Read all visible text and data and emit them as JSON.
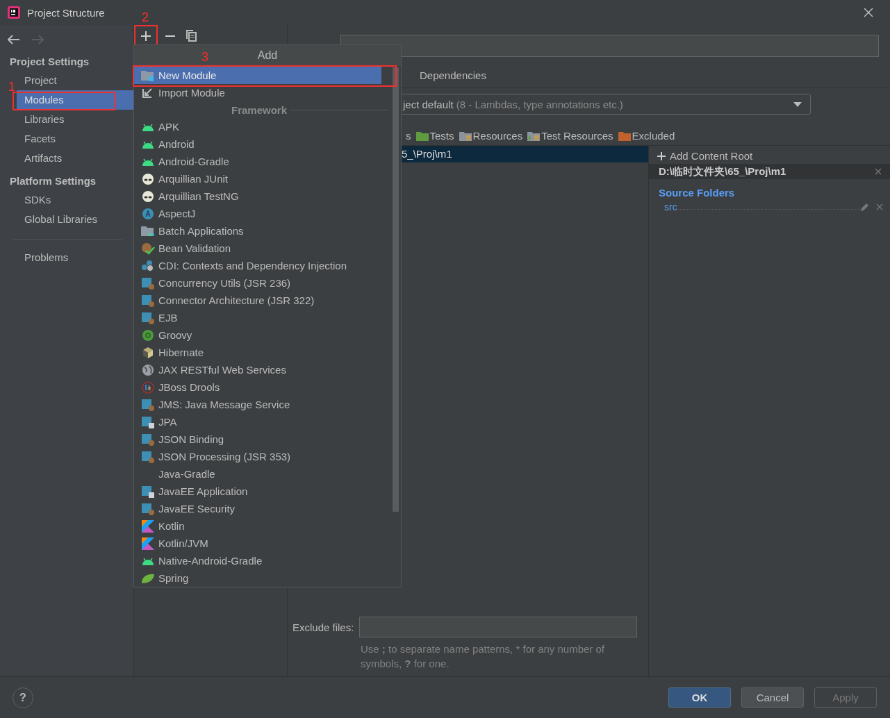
{
  "window": {
    "title": "Project Structure"
  },
  "sidebar": {
    "groups": [
      {
        "heading": "Project Settings",
        "items": [
          {
            "label": "Project",
            "selected": false
          },
          {
            "label": "Modules",
            "selected": true,
            "annotation": "1"
          },
          {
            "label": "Libraries",
            "selected": false
          },
          {
            "label": "Facets",
            "selected": false
          },
          {
            "label": "Artifacts",
            "selected": false
          }
        ]
      },
      {
        "heading": "Platform Settings",
        "items": [
          {
            "label": "SDKs",
            "selected": false
          },
          {
            "label": "Global Libraries",
            "selected": false
          }
        ]
      },
      {
        "items": [
          {
            "label": "Problems",
            "selected": false
          }
        ]
      }
    ]
  },
  "toolbar": {
    "add_annotation": "2"
  },
  "add_popup": {
    "title": "Add",
    "actions": [
      {
        "label": "New Module",
        "kind": "module",
        "selected": true,
        "annotation": "3"
      },
      {
        "label": "Import Module",
        "kind": "import",
        "selected": false
      }
    ],
    "section": "Framework",
    "frameworks": [
      {
        "label": "APK",
        "kind": "android",
        "selected": false
      },
      {
        "label": "Android",
        "kind": "android",
        "selected": false
      },
      {
        "label": "Android-Gradle",
        "kind": "android",
        "selected": false
      },
      {
        "label": "Arquillian JUnit",
        "kind": "alien",
        "selected": false
      },
      {
        "label": "Arquillian TestNG",
        "kind": "alien",
        "selected": false
      },
      {
        "label": "AspectJ",
        "kind": "aspectj",
        "selected": false
      },
      {
        "label": "Batch Applications",
        "kind": "batch",
        "selected": false
      },
      {
        "label": "Bean Validation",
        "kind": "bean",
        "selected": false
      },
      {
        "label": "CDI: Contexts and Dependency Injection",
        "kind": "cdi",
        "selected": false
      },
      {
        "label": "Concurrency Utils (JSR 236)",
        "kind": "jee",
        "selected": false
      },
      {
        "label": "Connector Architecture (JSR 322)",
        "kind": "jee",
        "selected": false
      },
      {
        "label": "EJB",
        "kind": "jee",
        "selected": false
      },
      {
        "label": "Groovy",
        "kind": "groovy",
        "selected": false
      },
      {
        "label": "Hibernate",
        "kind": "hibernate",
        "selected": false
      },
      {
        "label": "JAX RESTful Web Services",
        "kind": "globe",
        "selected": false
      },
      {
        "label": "JBoss Drools",
        "kind": "drools",
        "selected": false
      },
      {
        "label": "JMS: Java Message Service",
        "kind": "jee",
        "selected": false
      },
      {
        "label": "JPA",
        "kind": "jpa",
        "selected": false
      },
      {
        "label": "JSON Binding",
        "kind": "jee",
        "selected": false
      },
      {
        "label": "JSON Processing (JSR 353)",
        "kind": "jee",
        "selected": false
      },
      {
        "label": "Java-Gradle",
        "kind": "none",
        "selected": false
      },
      {
        "label": "JavaEE Application",
        "kind": "jeeapp",
        "selected": false
      },
      {
        "label": "JavaEE Security",
        "kind": "jee",
        "selected": false
      },
      {
        "label": "Kotlin",
        "kind": "kotlin",
        "selected": false
      },
      {
        "label": "Kotlin/JVM",
        "kind": "kotlin",
        "selected": false
      },
      {
        "label": "Native-Android-Gradle",
        "kind": "android",
        "selected": false
      },
      {
        "label": "Spring",
        "kind": "spring",
        "selected": false
      }
    ]
  },
  "tabs": [
    {
      "label": "Dependencies",
      "selected": false
    }
  ],
  "language_level": {
    "value": "ject default",
    "hint": "(8 - Lambdas, type annotations etc.)"
  },
  "folder_types": [
    {
      "label": "s",
      "kind": "cut"
    },
    {
      "label": "Tests",
      "kind": "tests"
    },
    {
      "label": "Resources",
      "kind": "resources"
    },
    {
      "label": "Test Resources",
      "kind": "test-resources"
    },
    {
      "label": "Excluded",
      "kind": "excluded"
    }
  ],
  "content_tree": [
    {
      "label": "5_\\Proj\\m1",
      "selected": true
    }
  ],
  "content_root": {
    "add_label": "Add Content Root",
    "path": "D:\\临时文件夹\\65_\\Proj\\m1",
    "section": "Source Folders",
    "folders": [
      "src"
    ]
  },
  "exclude": {
    "label": "Exclude files:",
    "hint_parts": [
      {
        "text": "Use ",
        "bold": false
      },
      {
        "text": ";",
        "bold": true
      },
      {
        "text": " to separate name patterns, * for any number of symbols, ",
        "bold": false
      },
      {
        "text": "?",
        "bold": true
      },
      {
        "text": " for one.",
        "bold": false
      }
    ]
  },
  "help_button": "?",
  "buttons": [
    {
      "label": "OK",
      "default": true,
      "disabled": false
    },
    {
      "label": "Cancel",
      "default": false,
      "disabled": false
    },
    {
      "label": "Apply",
      "default": false,
      "disabled": true
    }
  ]
}
